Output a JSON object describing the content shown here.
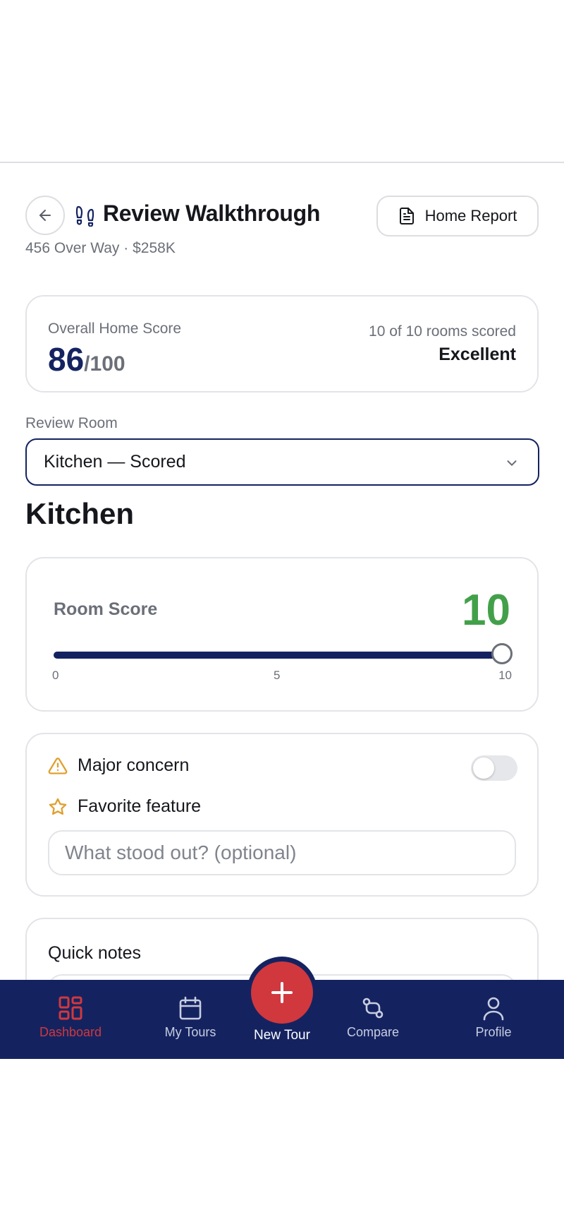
{
  "header": {
    "title": "Review Walkthrough",
    "subtitle": "456 Over Way · $258K",
    "report_button": "Home Report"
  },
  "overall": {
    "label": "Overall Home Score",
    "score": "86",
    "out_of": "/100",
    "rooms_scored": "10 of 10 rooms scored",
    "rating": "Excellent"
  },
  "review_room": {
    "label": "Review Room",
    "selected": "Kitchen — Scored"
  },
  "room": {
    "title": "Kitchen",
    "score_label": "Room Score",
    "score": "10",
    "slider": {
      "min": 0,
      "max": 10,
      "value": 10,
      "ticks": [
        "0",
        "5",
        "10"
      ]
    }
  },
  "flags": {
    "major_concern": "Major concern",
    "major_concern_on": false,
    "favorite_feature": "Favorite feature",
    "favorite_placeholder": "What stood out? (optional)"
  },
  "notes": {
    "label": "Quick notes"
  },
  "nav": {
    "items": [
      {
        "label": "Dashboard",
        "icon": "dashboard-icon",
        "active": true
      },
      {
        "label": "My Tours",
        "icon": "calendar-icon",
        "active": false
      },
      {
        "label": "New Tour",
        "icon": "plus-icon",
        "active": false
      },
      {
        "label": "Compare",
        "icon": "compare-icon",
        "active": false
      },
      {
        "label": "Profile",
        "icon": "profile-icon",
        "active": false
      }
    ]
  },
  "colors": {
    "primary": "#142360",
    "accent": "#d0383e",
    "success": "#43a04a",
    "warning": "#e0a030"
  }
}
